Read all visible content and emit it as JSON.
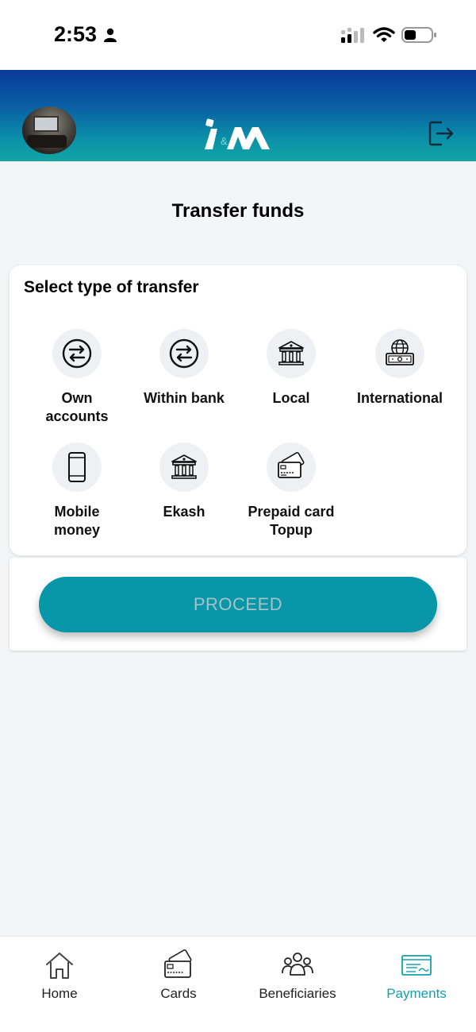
{
  "status_bar": {
    "time": "2:53",
    "icons": [
      "person-icon",
      "cellular-signal-icon",
      "wifi-icon",
      "battery-icon"
    ]
  },
  "header": {
    "logo_text": "I&M",
    "icons": [
      "avatar",
      "logout-icon"
    ]
  },
  "page": {
    "title": "Transfer funds"
  },
  "transfer_types": {
    "heading": "Select type of transfer",
    "items": [
      {
        "label": "Own accounts",
        "line1": "Own",
        "line2": "accounts",
        "icon": "transfer-arrows-icon"
      },
      {
        "label": "Within bank",
        "line1": "Within bank",
        "line2": "",
        "icon": "transfer-arrows-icon"
      },
      {
        "label": "Local",
        "line1": "Local",
        "line2": "",
        "icon": "bank-icon"
      },
      {
        "label": "International",
        "line1": "International",
        "line2": "",
        "icon": "globe-money-icon"
      },
      {
        "label": "Mobile money",
        "line1": "Mobile",
        "line2": "money",
        "icon": "mobile-phone-icon"
      },
      {
        "label": "Ekash",
        "line1": "Ekash",
        "line2": "",
        "icon": "bank-icon"
      },
      {
        "label": "Prepaid card Topup",
        "line1": "Prepaid card",
        "line2": "Topup",
        "icon": "cards-icon"
      }
    ]
  },
  "proceed": {
    "label": "PROCEED",
    "enabled": false
  },
  "bottom_nav": {
    "items": [
      {
        "label": "Home",
        "icon": "home-icon",
        "active": false
      },
      {
        "label": "Cards",
        "icon": "cards-icon",
        "active": false
      },
      {
        "label": "Beneficiaries",
        "icon": "people-icon",
        "active": false
      },
      {
        "label": "Payments",
        "icon": "payment-check-icon",
        "active": true
      }
    ]
  },
  "colors": {
    "accent": "#0797a8",
    "active_nav": "#14a0ad",
    "header_top": "#0a3a9a",
    "header_bottom": "#12a6a6",
    "background": "#f4f5f7"
  }
}
